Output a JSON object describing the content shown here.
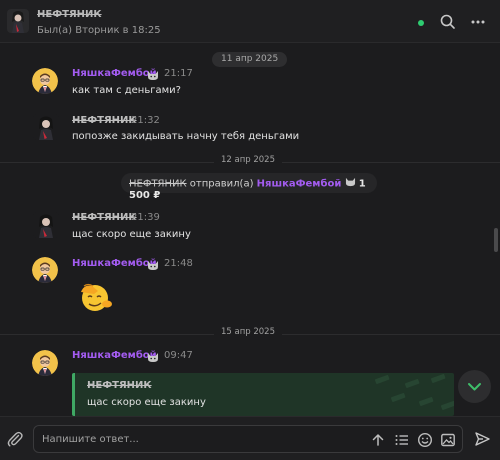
{
  "header": {
    "name": "НЕФТЯНИК",
    "status": "Был(а) Вторник в 18:25",
    "online_color": "#2ecc71",
    "icons": [
      "search-icon",
      "more-vertical-icon"
    ]
  },
  "dates": {
    "d1": "11 апр 2025",
    "d2": "12 апр 2025",
    "d3": "15 апр 2025"
  },
  "messages": [
    {
      "author": "НяшкаФембой",
      "time": "21:17",
      "text": "как там с деньгами?"
    },
    {
      "author": "НЕФТЯНИК",
      "time": "21:32",
      "text": "попозже закидывать начну тебя деньгами"
    },
    {
      "author": "НЕФТЯНИК",
      "time": "21:39",
      "text": "щас скоро еще закину"
    },
    {
      "author": "НяшкаФембой",
      "time": "21:48",
      "emoji": "🫡"
    },
    {
      "author": "НяшкаФембой",
      "time": "09:47",
      "reply_author": "НЕФТЯНИК",
      "reply_text": "щас скоро еще закину"
    }
  ],
  "transfer": {
    "sender": "НЕФТЯНИК",
    "verb": "отправил(а)",
    "recipient": "НяшкаФембой",
    "amount": "1 500 ₽"
  },
  "composer": {
    "placeholder": "Напишите ответ..."
  },
  "colors": {
    "accent_purple": "#a35cf0",
    "quote_green": "#3fa864",
    "background": "#1c1c1e"
  }
}
